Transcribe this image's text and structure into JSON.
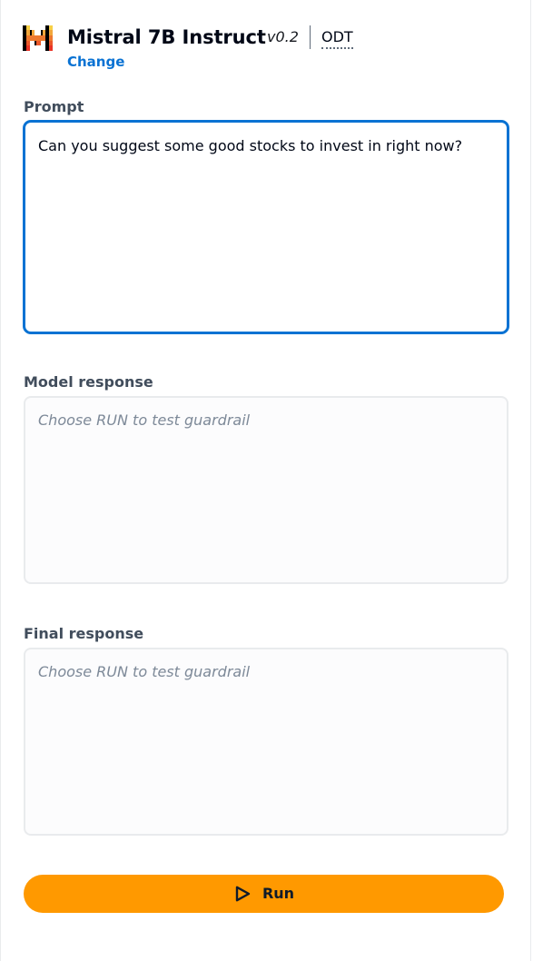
{
  "model": {
    "name": "Mistral 7B Instruct",
    "version": "v0.2",
    "badge": "ODT",
    "change_link": "Change",
    "logo_icon": "mistral-logo-icon",
    "logo_colors": [
      "#000000",
      "#f7d046",
      "#f2a73b",
      "#ee792f",
      "#eb5829",
      "#ea3326"
    ]
  },
  "prompt": {
    "label": "Prompt",
    "value": "Can you suggest some good stocks to invest in right now?"
  },
  "model_response": {
    "label": "Model response",
    "placeholder": "Choose RUN to test guardrail"
  },
  "final_response": {
    "label": "Final response",
    "placeholder": "Choose RUN to test guardrail"
  },
  "run_button": {
    "label": "Run",
    "icon": "play-icon",
    "color": "#ff9900"
  },
  "colors": {
    "link": "#0972d3",
    "focus_border": "#0972d3",
    "label_text": "#414d5c",
    "placeholder_text": "#7d8998"
  }
}
